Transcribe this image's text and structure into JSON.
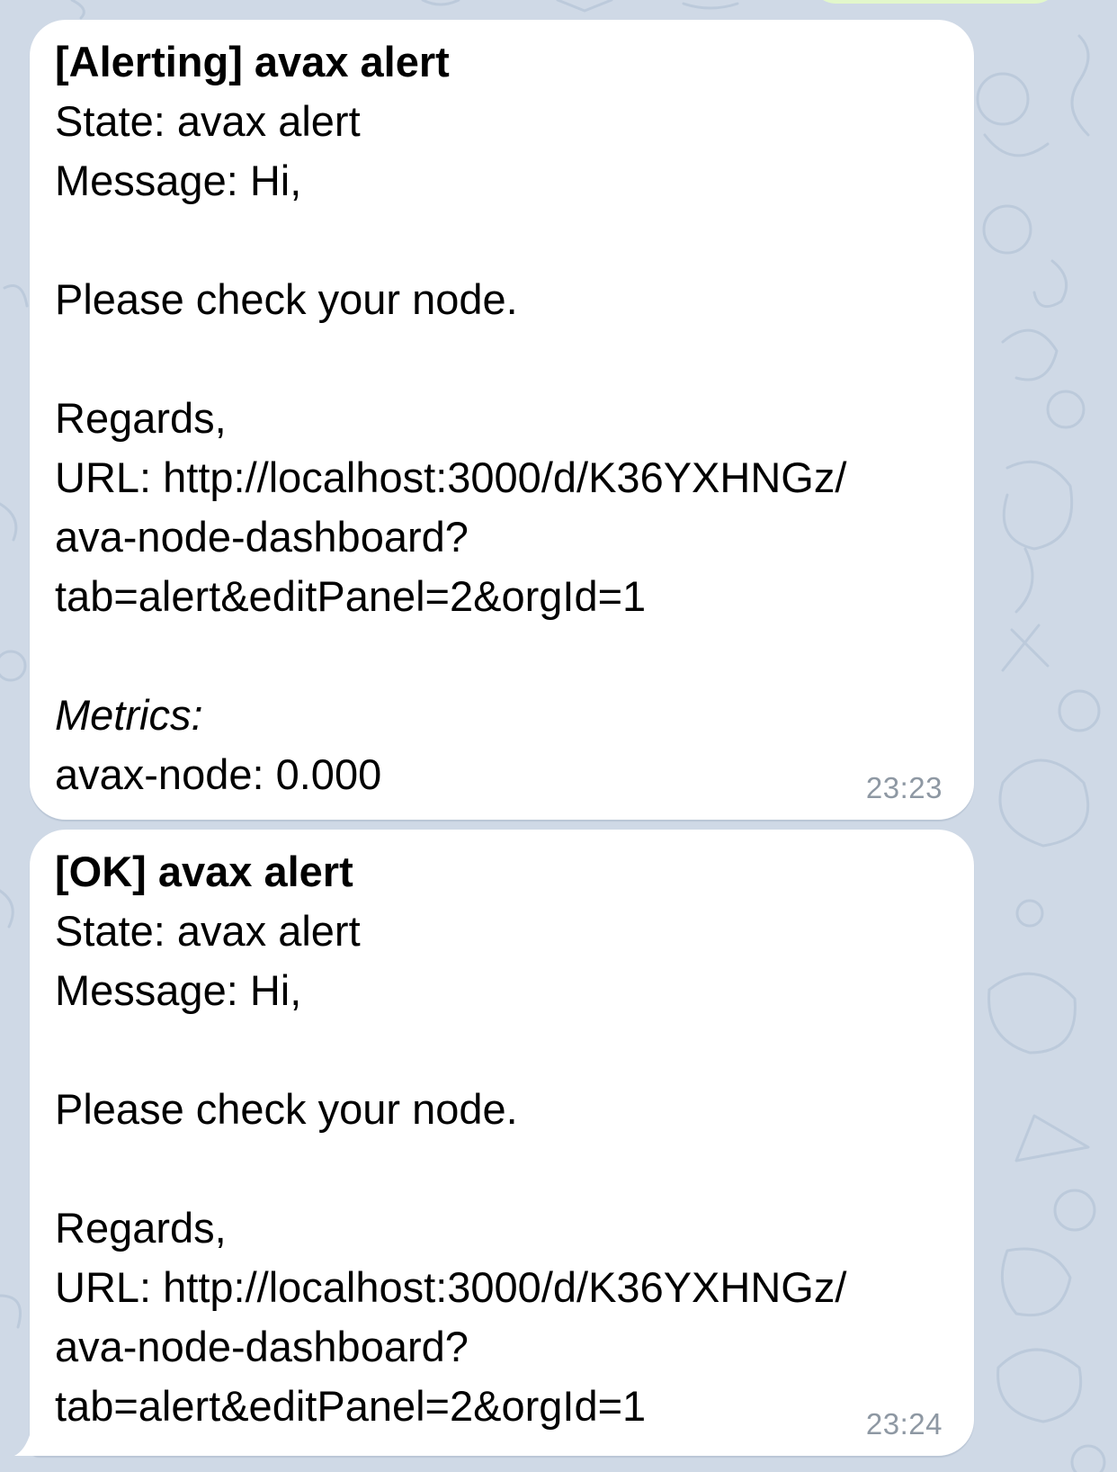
{
  "messages": [
    {
      "title": "[Alerting] avax alert",
      "state": "State: avax alert",
      "message": "Message: Hi,",
      "body": "Please check your node.",
      "regards": "Regards,",
      "url_line_1": "URL: http://localhost:3000/d/K36YXHNGz/",
      "url_line_2": "ava-node-dashboard?",
      "url_line_3": "tab=alert&editPanel=2&orgId=1",
      "metrics_label": "Metrics:",
      "metrics_value": "avax-node: 0.000",
      "time": "23:23"
    },
    {
      "title": "[OK] avax alert",
      "state": "State: avax alert",
      "message": "Message: Hi,",
      "body": "Please check your node.",
      "regards": "Regards,",
      "url_line_1": "URL: http://localhost:3000/d/K36YXHNGz/",
      "url_line_2": "ava-node-dashboard?",
      "url_line_3": "tab=alert&editPanel=2&orgId=1",
      "time": "23:24"
    }
  ],
  "colors": {
    "background": "#cfd9e6",
    "bubble": "#ffffff",
    "timestamp": "#8e98a3",
    "outgoing_bubble": "#e2f7cb"
  }
}
